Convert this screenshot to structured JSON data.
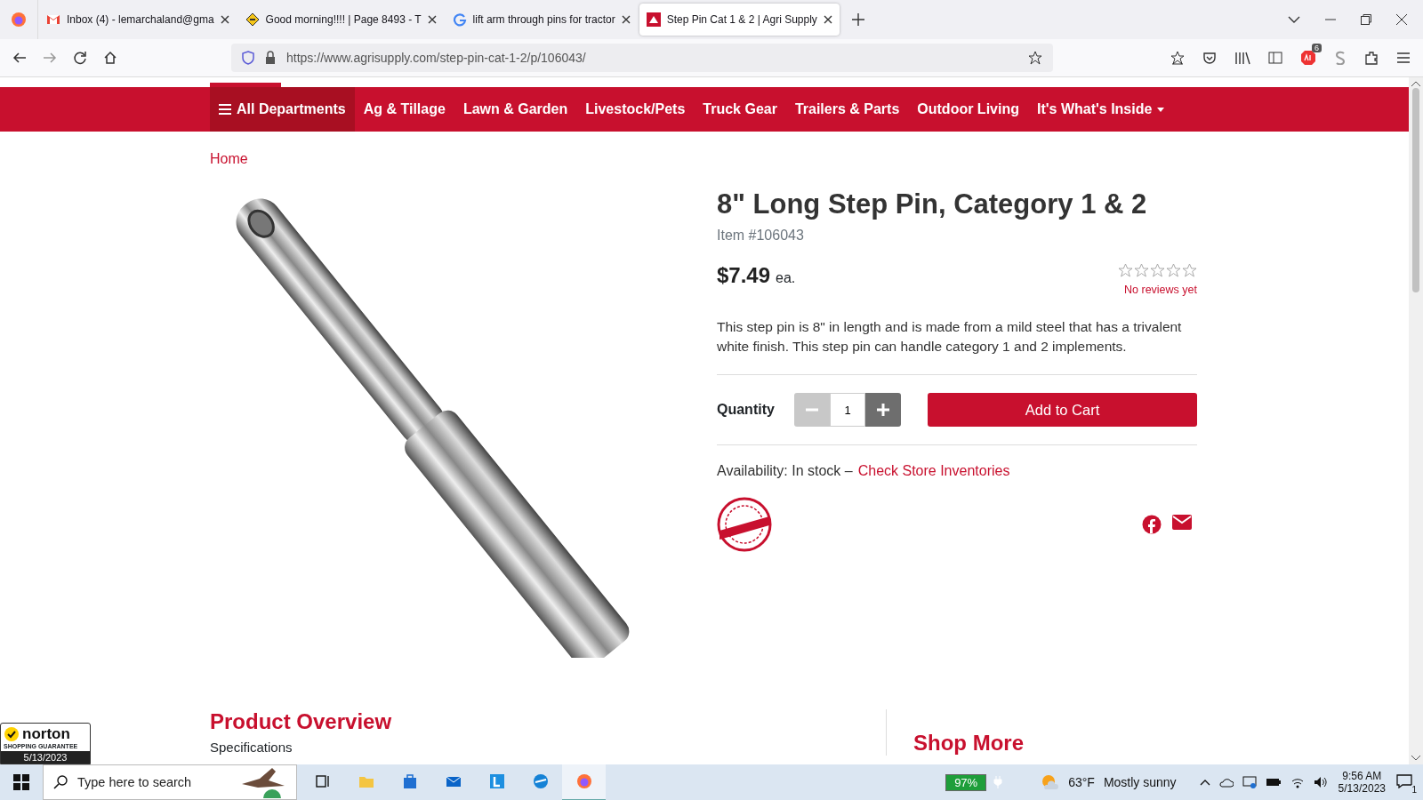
{
  "browser": {
    "tabs": [
      {
        "title": "Inbox (4) - lemarchaland@gma",
        "selected": false
      },
      {
        "title": "Good morning!!!! | Page 8493 - T",
        "selected": false
      },
      {
        "title": "lift arm through pins for tractor",
        "selected": false
      },
      {
        "title": "Step Pin Cat 1 & 2 | Agri Supply",
        "selected": true
      }
    ],
    "url": "https://www.agrisupply.com/step-pin-cat-1-2/p/106043/",
    "addon_badge": "6"
  },
  "nav": {
    "items": [
      {
        "label": "All Departments",
        "kind": "menu"
      },
      {
        "label": "Ag & Tillage",
        "kind": "link"
      },
      {
        "label": "Lawn & Garden",
        "kind": "link"
      },
      {
        "label": "Livestock/Pets",
        "kind": "link"
      },
      {
        "label": "Truck Gear",
        "kind": "link"
      },
      {
        "label": "Trailers & Parts",
        "kind": "link"
      },
      {
        "label": "Outdoor Living",
        "kind": "link"
      },
      {
        "label": "It's What's Inside",
        "kind": "dropdown"
      }
    ]
  },
  "breadcrumb": [
    "Home"
  ],
  "product": {
    "title": "8\" Long Step Pin, Category 1 & 2",
    "item": "Item #106043",
    "price": "$7.49",
    "unit": "ea.",
    "stars": 0,
    "reviews": "No reviews yet",
    "description": "This step pin is 8\" in length and is made from a mild steel that has a trivalent white finish. This step pin can handle category 1 and 2 implements.",
    "quantity_label": "Quantity",
    "quantity": "1",
    "minus_disabled": true,
    "add_button": "Add to Cart",
    "availability": "Availability: In stock –",
    "inventory_link": "Check Store Inventories"
  },
  "sections": {
    "overview": "Product Overview",
    "specifications": "Specifications",
    "shop_more": "Shop More"
  },
  "norton": {
    "brand": "norton",
    "label": "SHOPPING GUARANTEE",
    "date": "5/13/2023"
  },
  "taskbar": {
    "search_placeholder": "Type here to search",
    "battery": "97%",
    "temperature": "63°F",
    "weather": "Mostly sunny",
    "time": "9:56 AM",
    "date": "5/13/2023",
    "notifications": "1"
  }
}
